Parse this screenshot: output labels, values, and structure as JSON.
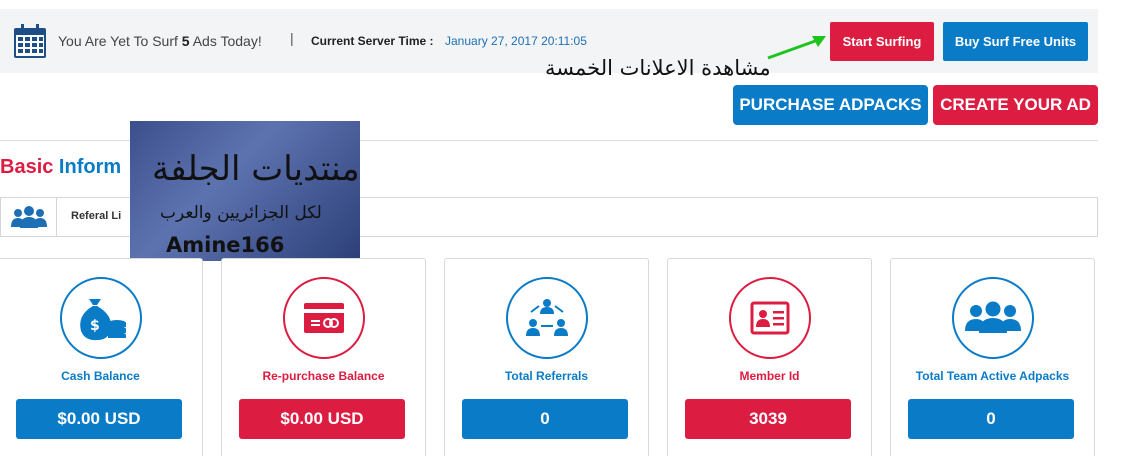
{
  "colors": {
    "blue": "#0a7bc7",
    "red": "#dd1c41",
    "server_time": "#1d6fb5"
  },
  "header": {
    "yet_prefix": "You Are Yet To Surf ",
    "yet_count": "5",
    "yet_suffix": " Ads Today!",
    "separator": "|",
    "server_label": "Current Server Time :",
    "server_time": "January 27, 2017 20:11:05",
    "calendar_icon": "calendar-icon"
  },
  "actions": {
    "start_surfing": "Start Surfing",
    "buy_units": "Buy Surf Free Units",
    "purchase_adpacks": "PURCHASE ADPACKS",
    "create_ad": "CREATE YOUR AD"
  },
  "annotation": {
    "arabic_note": "مشاهدة الاعلانات الخمسة",
    "arrow_color": "#1ec41e"
  },
  "watermark": {
    "line1": "منتديات الجلفة",
    "line2": "لكل الجزائريين والعرب",
    "name": "Amine166"
  },
  "basic": {
    "title_red": "Basic",
    "title_blue": " Inform"
  },
  "referral": {
    "label": "Referal Li",
    "icon": "users-icon"
  },
  "stats": [
    {
      "title": "Cash Balance",
      "value": "$0.00 USD",
      "icon": "money-bag-icon",
      "color": "blue"
    },
    {
      "title": "Re-purchase Balance",
      "value": "$0.00 USD",
      "icon": "credit-card-icon",
      "color": "red"
    },
    {
      "title": "Total Referrals",
      "value": "0",
      "icon": "network-icon",
      "color": "blue"
    },
    {
      "title": "Member Id",
      "value": "3039",
      "icon": "id-card-icon",
      "color": "red"
    },
    {
      "title": "Total Team Active Adpacks",
      "value": "0",
      "icon": "team-icon",
      "color": "blue"
    }
  ]
}
